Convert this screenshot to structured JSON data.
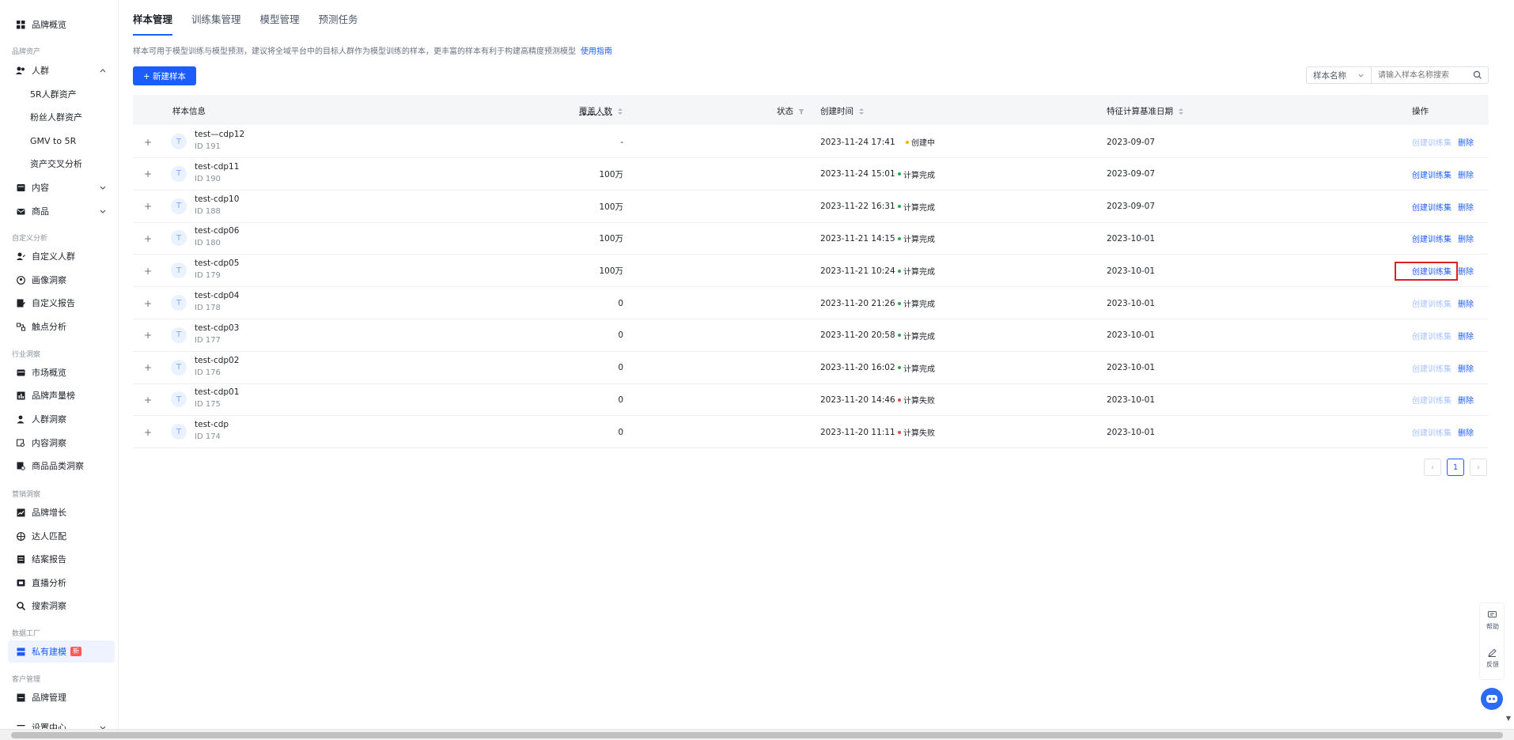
{
  "sidebar": {
    "top_item": "品牌概览",
    "groups": {
      "g1": "品牌资产",
      "g2": "自定义分析",
      "g3": "行业洞察",
      "g4": "营销洞察",
      "g5": "数据工厂",
      "g6": "客户管理"
    },
    "people": "人群",
    "people_sub": [
      "5R人群资产",
      "粉丝人群资产",
      "GMV to 5R",
      "资产交叉分析"
    ],
    "content": "内容",
    "goods": "商品",
    "custom": [
      "自定义人群",
      "画像洞察",
      "自定义报告",
      "触点分析"
    ],
    "industry": [
      "市场概览",
      "品牌声量榜",
      "人群洞察",
      "内容洞察",
      "商品品类洞察"
    ],
    "marketing": [
      "品牌增长",
      "达人匹配",
      "结案报告",
      "直播分析",
      "搜索洞察"
    ],
    "private_model": "私有建模",
    "new_badge": "新",
    "brand_mgmt": "品牌管理",
    "settings_partial": "设置中心"
  },
  "tabs": [
    "样本管理",
    "训练集管理",
    "模型管理",
    "预测任务"
  ],
  "description": "样本可用于模型训练与模型预测，建议将全域平台中的目标人群作为模型训练的样本，更丰富的样本有利于构建高精度预测模型",
  "guide_link": "使用指南",
  "new_sample_button": "+ 新建样本",
  "filter": {
    "select_value": "样本名称",
    "search_placeholder": "请输入样本名称搜索"
  },
  "table": {
    "headers": {
      "info": "样本信息",
      "coverage": "覆盖人数",
      "status": "状态",
      "created": "创建时间",
      "base_date": "特征计算基准日期",
      "actions": "操作"
    },
    "rows": [
      {
        "name": "test—cdp12",
        "id": "ID 191",
        "coverage": "-",
        "status": "创建中",
        "status_color": "#f5b400",
        "created": "2023-11-24 17:41",
        "base_date": "2023-09-07",
        "act1_disabled": true
      },
      {
        "name": "test-cdp11",
        "id": "ID 190",
        "coverage": "100万",
        "status": "计算完成",
        "status_color": "#22b14c",
        "created": "2023-11-24 15:01",
        "base_date": "2023-09-07",
        "act1_disabled": false
      },
      {
        "name": "test-cdp10",
        "id": "ID 188",
        "coverage": "100万",
        "status": "计算完成",
        "status_color": "#22b14c",
        "created": "2023-11-22 16:31",
        "base_date": "2023-09-07",
        "act1_disabled": false
      },
      {
        "name": "test-cdp06",
        "id": "ID 180",
        "coverage": "100万",
        "status": "计算完成",
        "status_color": "#22b14c",
        "created": "2023-11-21 14:15",
        "base_date": "2023-10-01",
        "act1_disabled": false
      },
      {
        "name": "test-cdp05",
        "id": "ID 179",
        "coverage": "100万",
        "status": "计算完成",
        "status_color": "#22b14c",
        "created": "2023-11-21 10:24",
        "base_date": "2023-10-01",
        "act1_disabled": false
      },
      {
        "name": "test-cdp04",
        "id": "ID 178",
        "coverage": "0",
        "status": "计算完成",
        "status_color": "#22b14c",
        "created": "2023-11-20 21:26",
        "base_date": "2023-10-01",
        "act1_disabled": true
      },
      {
        "name": "test-cdp03",
        "id": "ID 177",
        "coverage": "0",
        "status": "计算完成",
        "status_color": "#22b14c",
        "created": "2023-11-20 20:58",
        "base_date": "2023-10-01",
        "act1_disabled": true
      },
      {
        "name": "test-cdp02",
        "id": "ID 176",
        "coverage": "0",
        "status": "计算完成",
        "status_color": "#22b14c",
        "created": "2023-11-20 16:02",
        "base_date": "2023-10-01",
        "act1_disabled": true
      },
      {
        "name": "test-cdp01",
        "id": "ID 175",
        "coverage": "0",
        "status": "计算失败",
        "status_color": "#f0453a",
        "created": "2023-11-20 14:46",
        "base_date": "2023-10-01",
        "act1_disabled": true
      },
      {
        "name": "test-cdp",
        "id": "ID 174",
        "coverage": "0",
        "status": "计算失败",
        "status_color": "#f0453a",
        "created": "2023-11-20 11:11",
        "base_date": "2023-10-01",
        "act1_disabled": true
      }
    ],
    "action_create": "创建训练集",
    "action_delete": "删除",
    "avatar_letter": "T",
    "expand_symbol": "+"
  },
  "pagination": {
    "prev": "‹",
    "current": "1",
    "next": "›"
  },
  "float": {
    "help": "帮助",
    "feedback": "反馈"
  }
}
